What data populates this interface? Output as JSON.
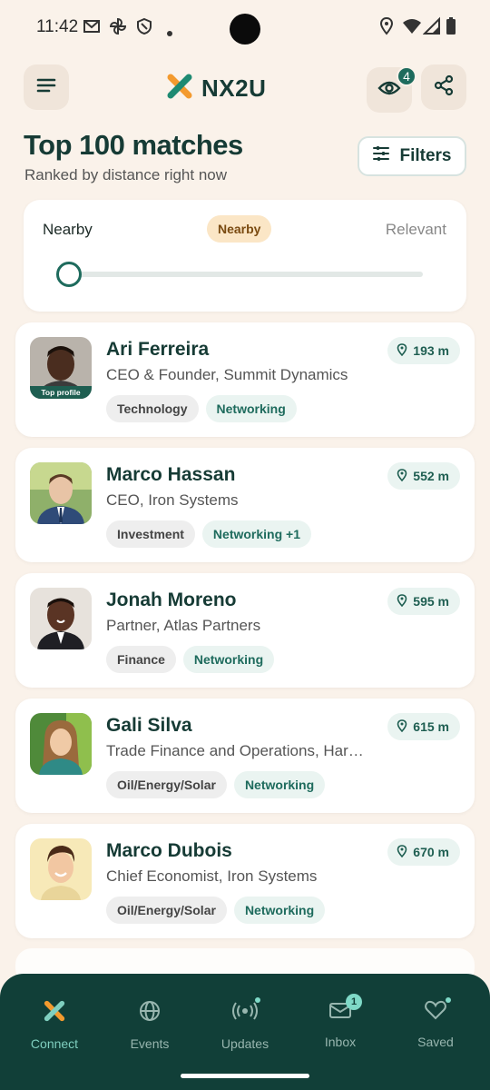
{
  "status_bar": {
    "time": "11:42"
  },
  "header": {
    "app_name": "NX2U",
    "views_badge": "4"
  },
  "page": {
    "title": "Top 100 matches",
    "subtitle": "Ranked by distance right now",
    "filters_label": "Filters"
  },
  "slider": {
    "left_label": "Nearby",
    "current_label": "Nearby",
    "right_label": "Relevant",
    "position": 0
  },
  "matches": [
    {
      "name": "Ari Ferreira",
      "role": "CEO & Founder, Summit Dynamics",
      "distance": "193 m",
      "tags": [
        "Technology",
        "Networking"
      ],
      "badge": "Top profile"
    },
    {
      "name": "Marco Hassan",
      "role": "CEO, Iron Systems",
      "distance": "552 m",
      "tags": [
        "Investment",
        "Networking +1"
      ]
    },
    {
      "name": "Jonah Moreno",
      "role": "Partner, Atlas Partners",
      "distance": "595 m",
      "tags": [
        "Finance",
        "Networking"
      ]
    },
    {
      "name": "Gali Silva",
      "role": "Trade Finance and Operations, Har…",
      "distance": "615 m",
      "tags": [
        "Oil/Energy/Solar",
        "Networking"
      ]
    },
    {
      "name": "Marco Dubois",
      "role": "Chief Economist, Iron Systems",
      "distance": "670 m",
      "tags": [
        "Oil/Energy/Solar",
        "Networking"
      ]
    }
  ],
  "nav": {
    "items": [
      {
        "label": "Connect"
      },
      {
        "label": "Events"
      },
      {
        "label": "Updates"
      },
      {
        "label": "Inbox",
        "badge": "1"
      },
      {
        "label": "Saved"
      }
    ]
  },
  "colors": {
    "accent": "#1e6b5d",
    "nav_bg": "#113f38",
    "background": "#faf2ea",
    "logo_orange": "#f39a2e",
    "logo_green": "#1e8a72"
  }
}
